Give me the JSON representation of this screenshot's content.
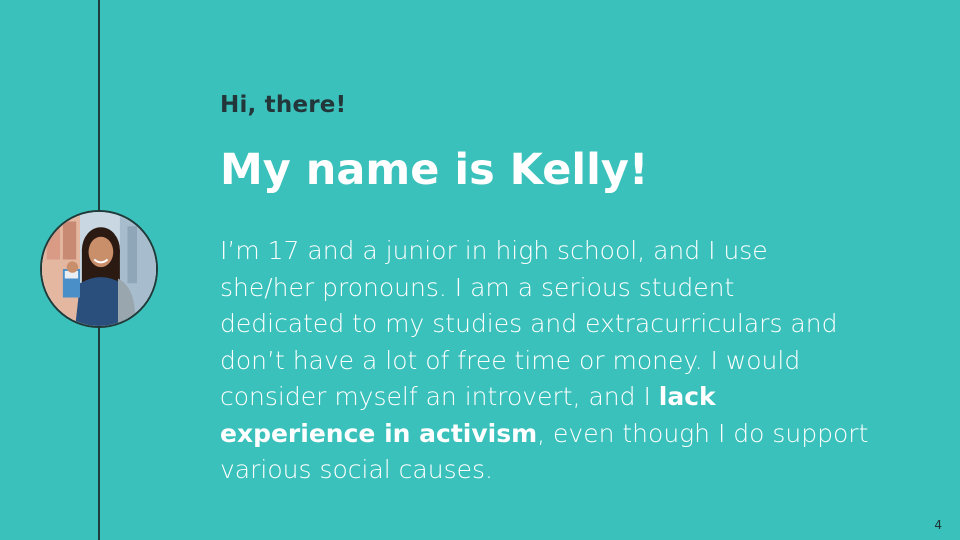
{
  "slide": {
    "greeting": "Hi, there!",
    "title": "My name is Kelly!",
    "bio_lines": [
      "I’m 17 and a junior in high school, and I use",
      "she/her pronouns. I am a serious student",
      "dedicated to my studies and extracurriculars and",
      "don’t have a lot of free time or money. I would",
      "consider myself an introvert, and I "
    ],
    "bio_bold_1": "lack",
    "bio_bold_2": "experience in activism",
    "bio_after_bold": ", even though I do support",
    "bio_last_line": "various social causes.",
    "page_number": "4"
  },
  "colors": {
    "background": "#3ac1bb",
    "title": "#ffffff",
    "greeting": "#23363a",
    "divider": "#1e3c3b"
  },
  "icons": {
    "avatar": "student-photo"
  }
}
